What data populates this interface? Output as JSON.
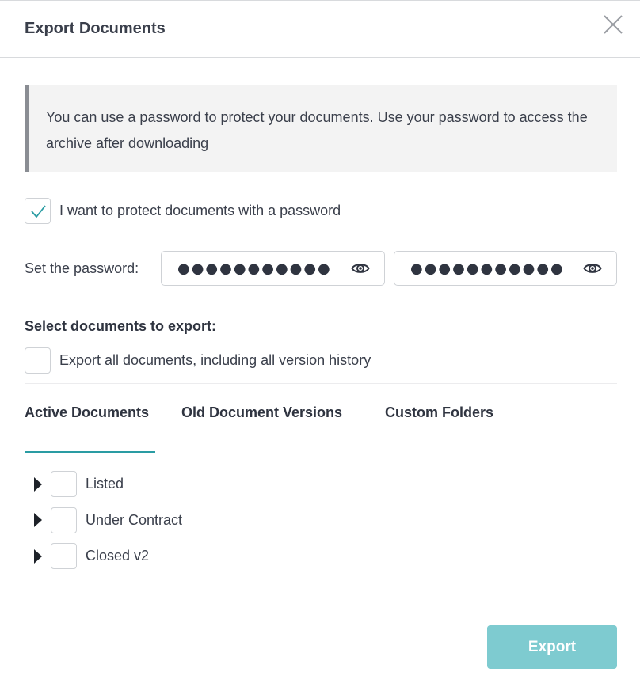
{
  "dialog": {
    "title": "Export Documents",
    "close_icon": "close-icon"
  },
  "info": {
    "text": "You can use a password to protect your documents. Use your password to access the archive after downloading"
  },
  "protect": {
    "label": "I want to protect documents with a password",
    "checked": true
  },
  "password": {
    "label": "Set the password:",
    "value": "●●●●●●●●●●●",
    "confirm_value": "●●●●●●●●●●●",
    "icon": "eye-icon"
  },
  "select": {
    "title": "Select documents to export:",
    "export_all_label": "Export all documents, including all version history",
    "export_all_checked": false
  },
  "tabs": [
    {
      "label": "Active Documents",
      "active": true
    },
    {
      "label": "Old Document Versions",
      "active": false
    },
    {
      "label": "Custom Folders",
      "active": false
    }
  ],
  "tree": [
    {
      "label": "Listed",
      "checked": false
    },
    {
      "label": "Under Contract",
      "checked": false
    },
    {
      "label": "Closed v2",
      "checked": false
    }
  ],
  "footer": {
    "export_label": "Export"
  },
  "colors": {
    "accent": "#2a9ca3",
    "export_button": "#7ecbd0",
    "info_background": "#f3f3f3",
    "info_border": "#8a8d93"
  }
}
